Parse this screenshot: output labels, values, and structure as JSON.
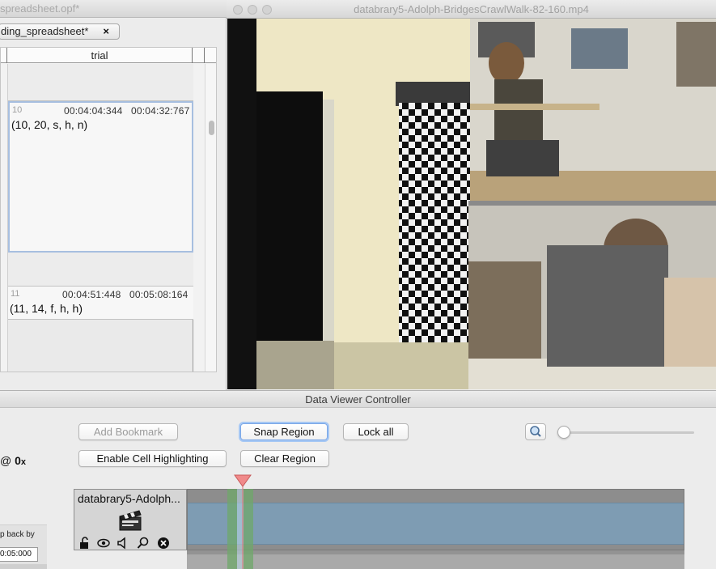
{
  "spreadsheet_window": {
    "title": "spreadsheet.opf*",
    "tab_label": "ding_spreadsheet*",
    "tab_close": "×",
    "column_header": "trial",
    "cells": [
      {
        "ordinal": "10",
        "onset": "00:04:04:344",
        "offset": "00:04:32:767",
        "value": "(10, 20, s, h, n)",
        "selected": true
      },
      {
        "ordinal": "11",
        "onset": "00:04:51:448",
        "offset": "00:05:08:164",
        "value": "(11, 14, f, h, h)",
        "selected": false
      }
    ]
  },
  "video_window": {
    "title": "databrary5-Adolph-BridgesCrawlWalk-82-160.mp4"
  },
  "controller": {
    "title": "Data Viewer Controller",
    "rate_prefix": "@",
    "rate_value": "0",
    "rate_suffix": "x",
    "buttons": {
      "add_bookmark": "Add Bookmark",
      "enable_cell_highlighting": "Enable Cell Highlighting",
      "snap_region": "Snap Region",
      "clear_region": "Clear Region",
      "lock_all": "Lock all"
    },
    "zoom_icon": "magnifier-icon",
    "zoom_slider_value": 0,
    "jump_back_label": "p back by",
    "jump_back_value": "0:05:000",
    "track": {
      "name": "databrary5-Adolph...",
      "icon": "clapperboard-icon",
      "controls": [
        "unlock-icon",
        "eye-icon",
        "speaker-icon",
        "magnifier-icon",
        "close-circle-icon"
      ]
    }
  },
  "colors": {
    "track_bar": "#7e9cb3",
    "region_marker": "#6fa86a",
    "needle": "#f08080",
    "selected_cell_border": "#a7bfe0"
  }
}
